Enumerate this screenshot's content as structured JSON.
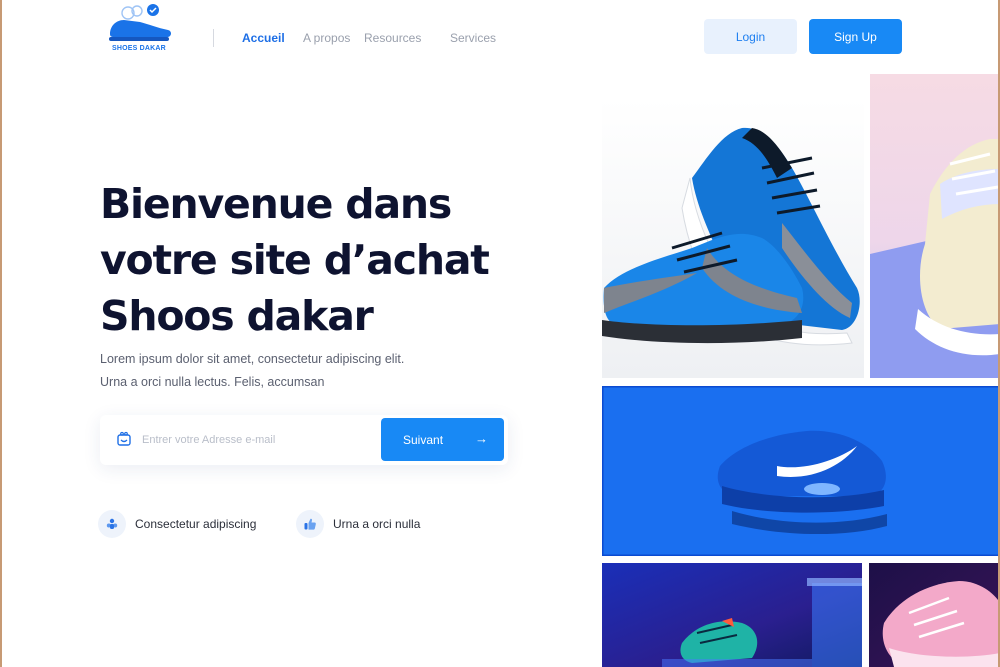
{
  "brand": {
    "name": "SHOES DAKAR",
    "accent": "#1889f5",
    "dark": "#0e1330"
  },
  "nav": {
    "items": [
      {
        "label": "Accueil",
        "active": true
      },
      {
        "label": "A propos",
        "active": false
      },
      {
        "label": "Resources",
        "active": false
      },
      {
        "label": "Services",
        "active": false
      }
    ]
  },
  "auth": {
    "login_label": "Login",
    "signup_label": "Sign Up"
  },
  "hero": {
    "title_line1": "Bienvenue dans",
    "title_line2": "votre site d’achat",
    "title_line3": "Shoos dakar",
    "subtitle_line1": "Lorem ipsum dolor sit amet, consectetur adipiscing elit.",
    "subtitle_line2": "Urna a orci nulla lectus. Felis, accumsan"
  },
  "email_form": {
    "icon": "mail-icon",
    "placeholder": "Entrer votre Adresse e-mail",
    "value": "",
    "submit_label": "Suivant",
    "submit_icon": "arrow-right-icon"
  },
  "features": [
    {
      "icon": "group-icon",
      "label": "Consectetur adipiscing"
    },
    {
      "icon": "thumbs-up-icon",
      "label": "Urna a orci nulla"
    }
  ],
  "gallery": [
    {
      "name": "blue-sneakers-pair"
    },
    {
      "name": "pastel-sneaker"
    },
    {
      "name": "blue-nike-sneaker"
    },
    {
      "name": "sneaker-on-display"
    },
    {
      "name": "pink-sneaker"
    }
  ]
}
